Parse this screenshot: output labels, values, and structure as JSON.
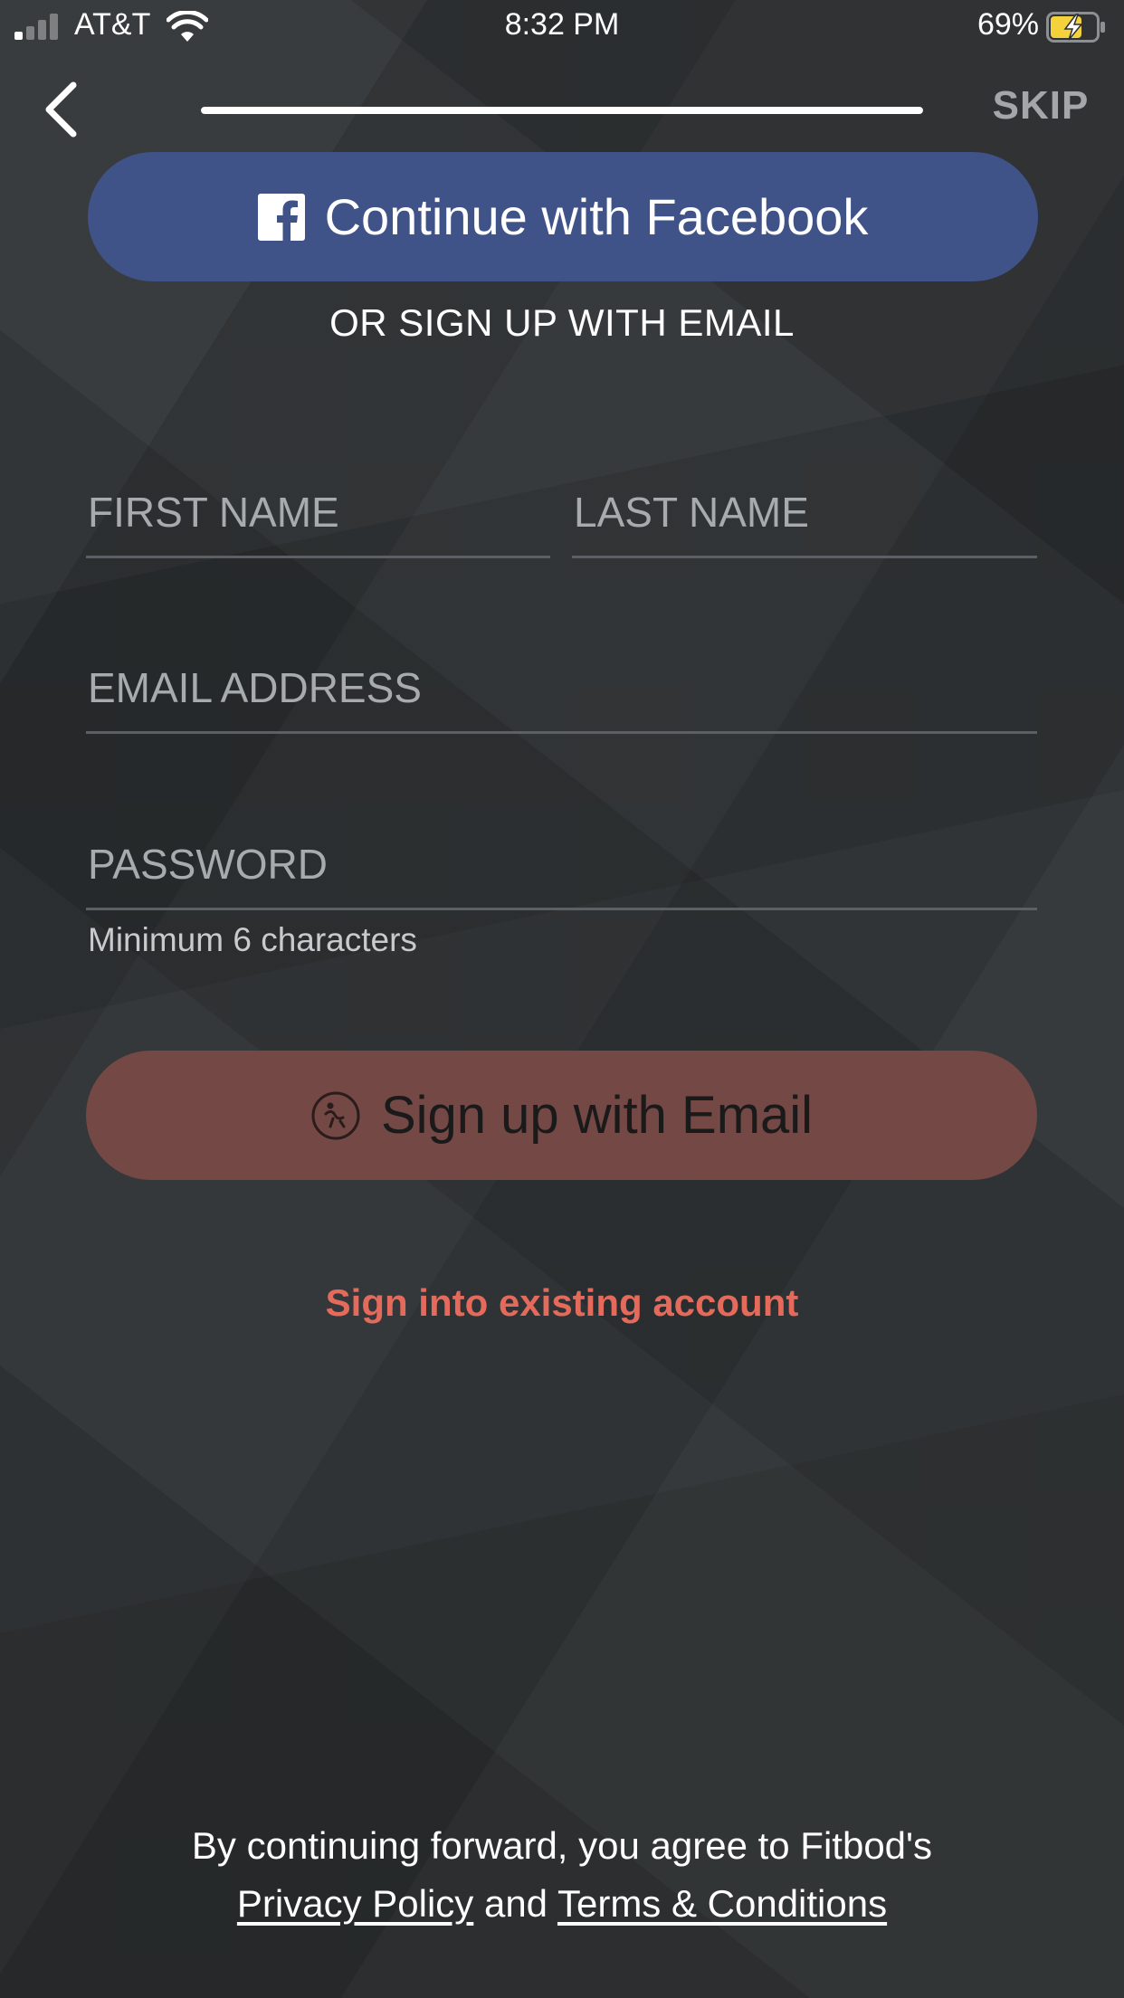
{
  "status_bar": {
    "carrier": "AT&T",
    "time": "8:32 PM",
    "battery_percent": "69%",
    "signal_bars_filled": 1,
    "signal_bars_total": 4,
    "charging": true
  },
  "header": {
    "back_icon": "chevron-left-icon",
    "progress": 1.0,
    "skip_label": "SKIP"
  },
  "facebook": {
    "label": "Continue with Facebook",
    "icon": "facebook-icon",
    "color": "#3f5388"
  },
  "divider_text": "OR SIGN UP WITH EMAIL",
  "form": {
    "first_name_placeholder": "FIRST NAME",
    "last_name_placeholder": "LAST NAME",
    "email_placeholder": "EMAIL ADDRESS",
    "password_placeholder": "PASSWORD",
    "password_hint": "Minimum 6 characters"
  },
  "signup_button": {
    "label": "Sign up with Email",
    "icon": "fitbod-logo-icon",
    "color": "#734845"
  },
  "signin_link": "Sign into existing account",
  "legal": {
    "prefix": "By continuing forward, you agree to Fitbod's",
    "privacy_label": "Privacy Policy",
    "conjunction": "and",
    "terms_label": "Terms & Conditions"
  },
  "colors": {
    "background": "#2b2e30",
    "accent": "#e46a5b",
    "field_underline": "#5c6064"
  }
}
